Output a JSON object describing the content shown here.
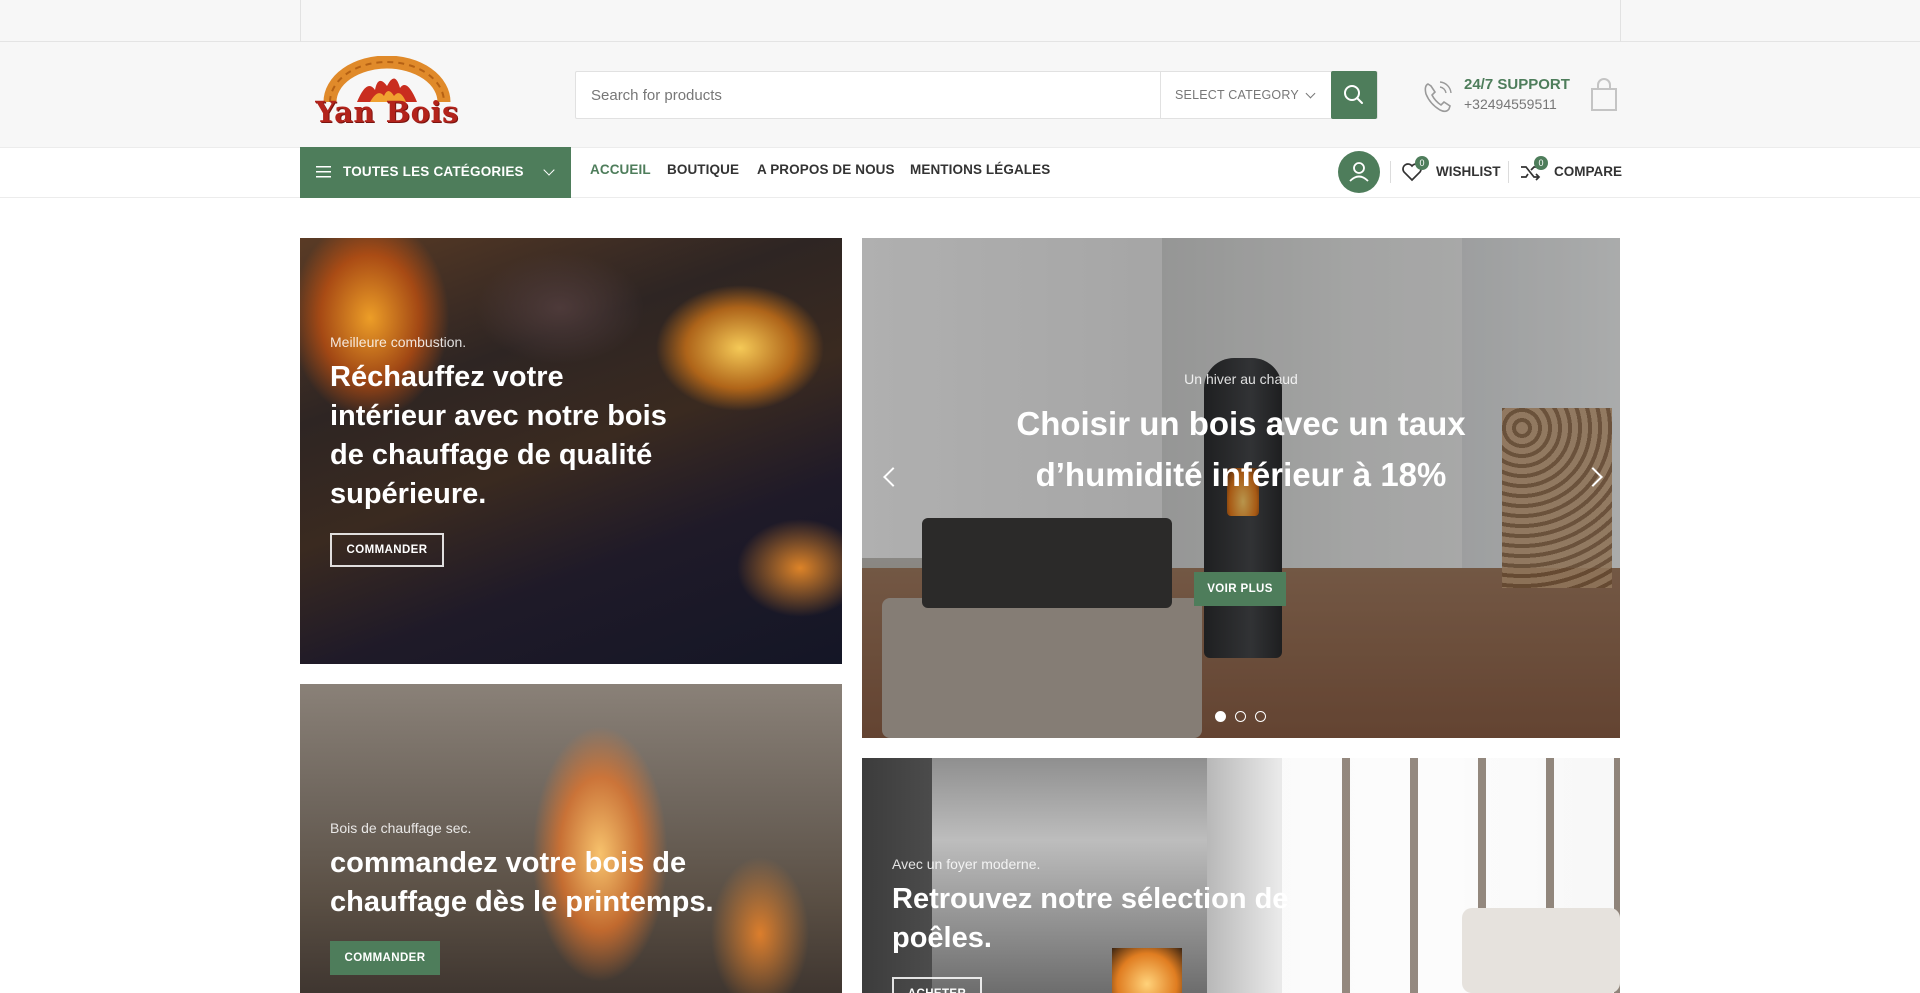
{
  "brand": {
    "name": "Yan Bois",
    "accent_color": "#4e7d5b",
    "logo_color": "#b3231b"
  },
  "search": {
    "placeholder": "Search for products",
    "category_label": "SELECT CATEGORY"
  },
  "support": {
    "title": "24/7 SUPPORT",
    "phone": "+32494559511"
  },
  "nav": {
    "categories_label": "TOUTES LES CATÉGORIES",
    "items": [
      {
        "label": "ACCUEIL",
        "active": true
      },
      {
        "label": "BOUTIQUE",
        "active": false
      },
      {
        "label": "A PROPOS DE NOUS",
        "active": false
      },
      {
        "label": "MENTIONS LÉGALES",
        "active": false
      }
    ],
    "wishlist": {
      "label": "WISHLIST",
      "count": "0"
    },
    "compare": {
      "label": "COMPARE",
      "count": "0"
    }
  },
  "banners": {
    "b1": {
      "subtitle": "Meilleure combustion.",
      "headline": "Réchauffez votre intérieur avec notre bois de chauffage de qualité supérieure.",
      "button": "COMMANDER"
    },
    "slider": {
      "subtitle": "Un hiver au chaud",
      "headline": "Choisir un bois avec un taux d’humidité inférieur à 18%",
      "button": "VOIR PLUS",
      "slides": 3,
      "active_slide": 1
    },
    "b3": {
      "subtitle": "Bois de chauffage sec.",
      "headline": "commandez votre bois de chauffage dès le printemps.",
      "button": "COMMANDER"
    },
    "b4": {
      "subtitle": "Avec un foyer moderne.",
      "headline": "Retrouvez notre sélection de poêles.",
      "button": "ACHETER"
    }
  },
  "icons": [
    "logo-arch-icon",
    "search-icon",
    "phone-icon",
    "cart-icon",
    "menu-icon",
    "user-icon",
    "heart-icon",
    "compare-icon",
    "chevron-left-icon",
    "chevron-right-icon"
  ]
}
